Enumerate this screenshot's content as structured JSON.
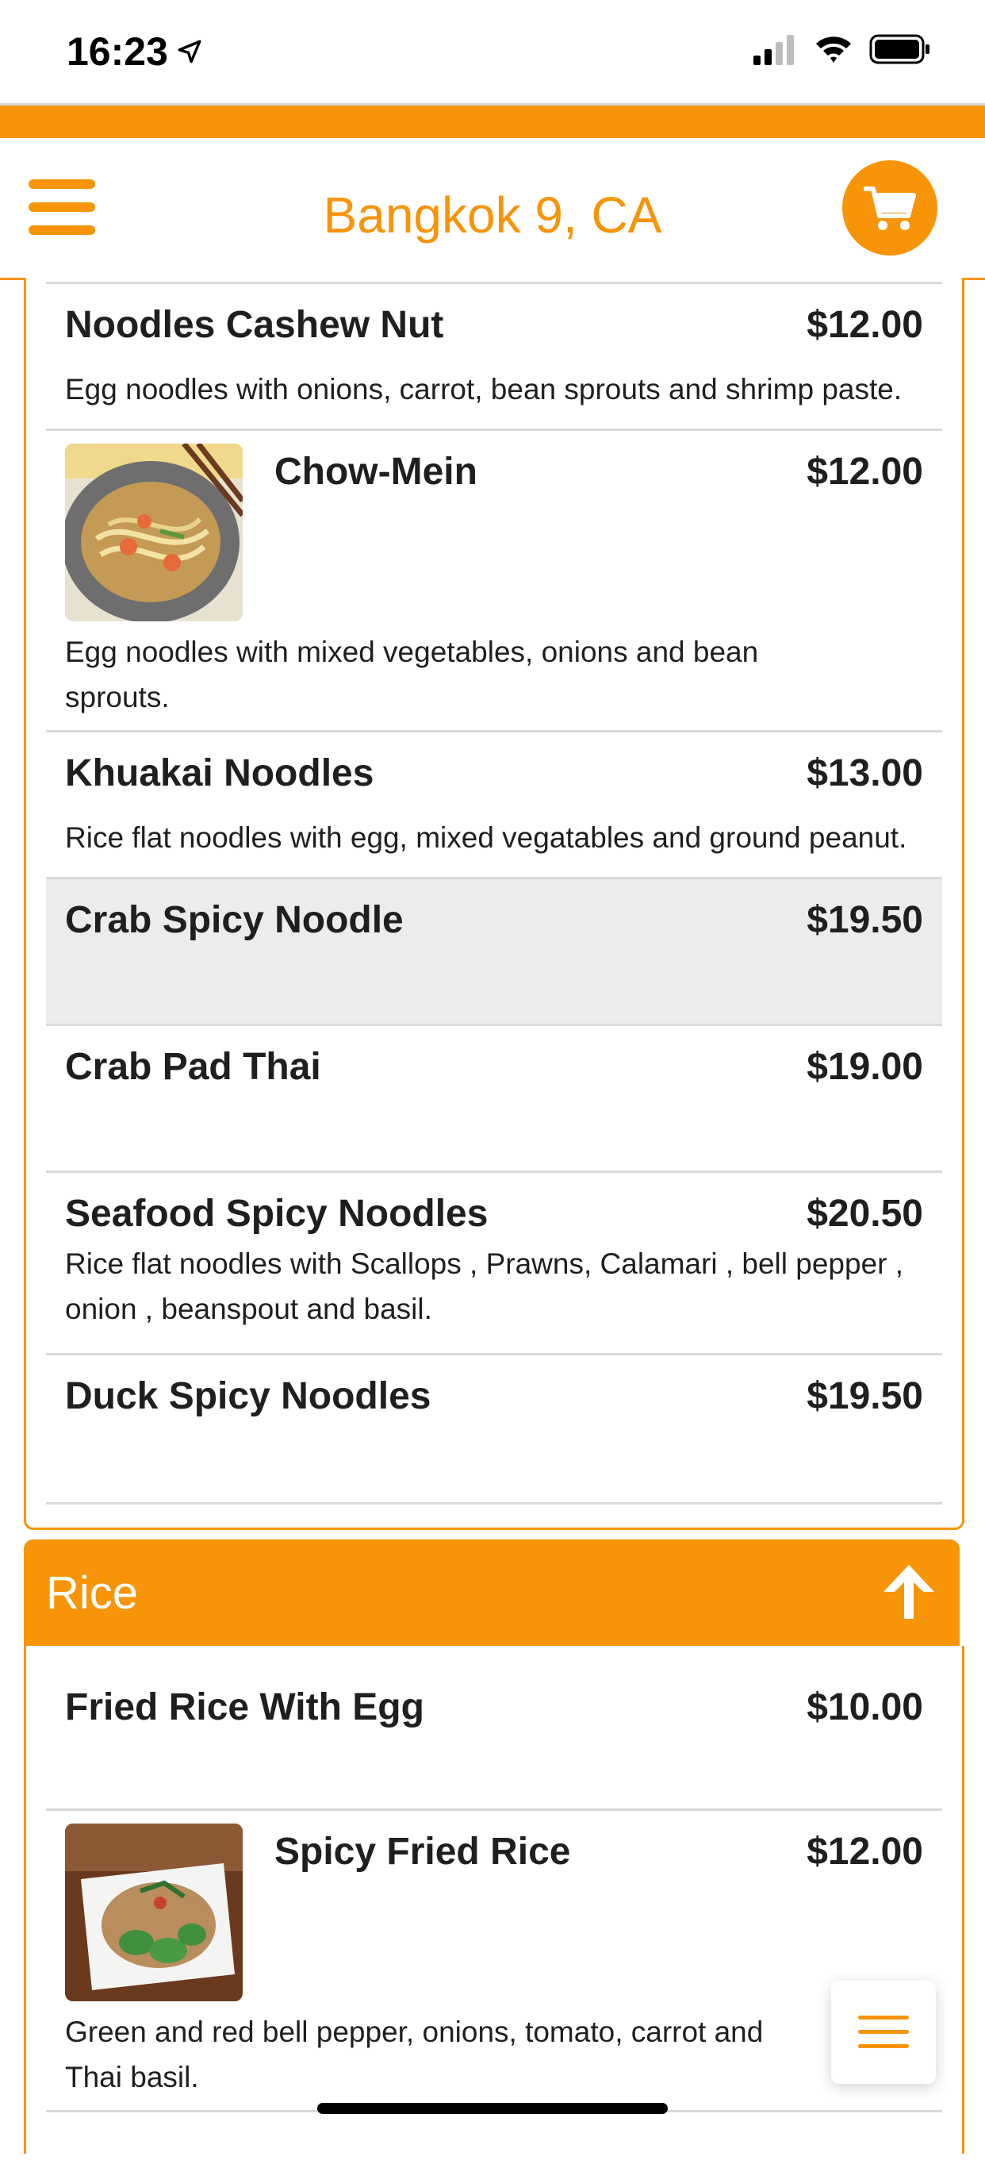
{
  "status_bar": {
    "time": "16:23"
  },
  "header": {
    "title": "Bangkok 9, CA"
  },
  "noodles_items": [
    {
      "name": "Noodles Cashew Nut",
      "price": "$12.00",
      "desc": "Egg noodles with onions, carrot, bean sprouts and shrimp paste."
    },
    {
      "name": "Chow-Mein",
      "price": "$12.00",
      "desc": "Egg noodles with mixed vegetables, onions and bean sprouts."
    },
    {
      "name": "Khuakai Noodles",
      "price": "$13.00",
      "desc": "Rice flat noodles with egg, mixed vegatables and ground peanut."
    },
    {
      "name": "Crab Spicy Noodle",
      "price": "$19.50"
    },
    {
      "name": "Crab Pad Thai",
      "price": "$19.00"
    },
    {
      "name": "Seafood Spicy Noodles",
      "price": "$20.50",
      "desc": "Rice flat noodles with Scallops , Prawns, Calamari , bell pepper , onion , beanspout and basil."
    },
    {
      "name": "Duck Spicy Noodles",
      "price": "$19.50"
    }
  ],
  "rice_section": {
    "title": "Rice",
    "items": [
      {
        "name": "Fried Rice With Egg",
        "price": "$10.00"
      },
      {
        "name": "Spicy Fried Rice",
        "price": "$12.00",
        "desc": "Green and red bell pepper, onions, tomato, carrot and Thai basil."
      }
    ]
  },
  "colors": {
    "accent": "#F79407",
    "selected_row": "#ececec"
  },
  "icons": [
    "location-arrow-icon",
    "signal-icon",
    "wifi-icon",
    "battery-icon",
    "hamburger-menu-icon",
    "cart-icon",
    "arrow-up-icon",
    "noodle-dish-photo",
    "rice-dish-photo"
  ]
}
